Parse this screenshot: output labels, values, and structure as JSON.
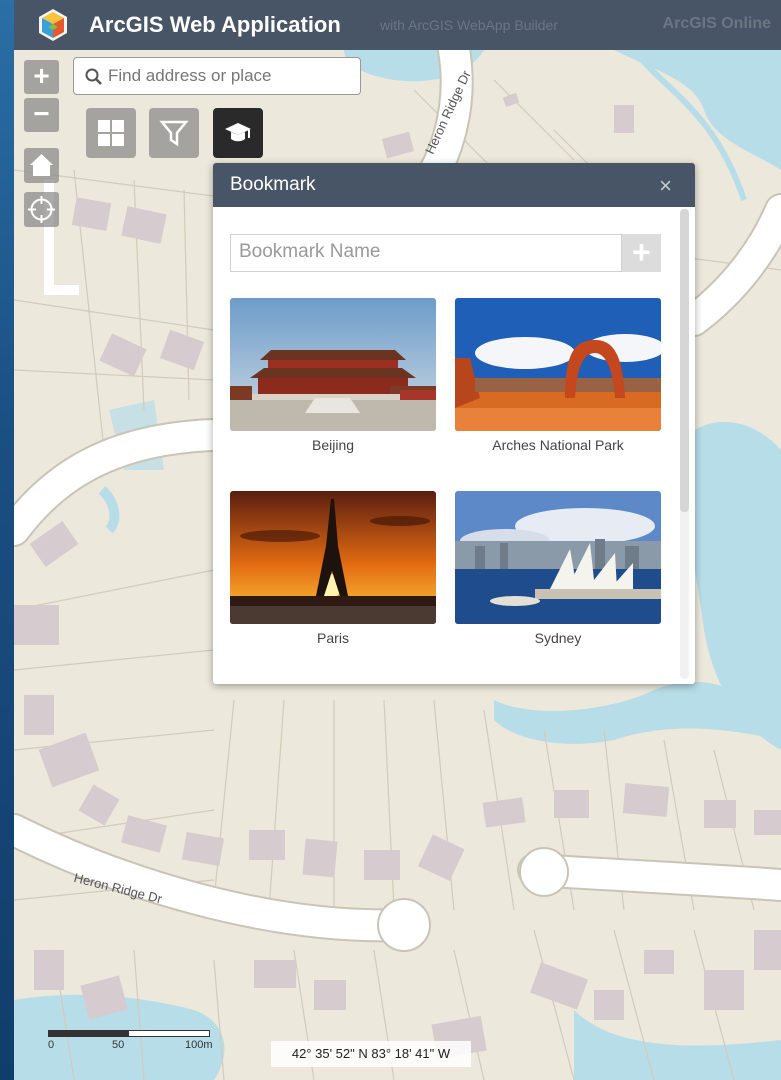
{
  "header": {
    "title": "ArcGIS Web Application",
    "subtitle": "with ArcGIS WebApp Builder",
    "right_link": "ArcGIS Online"
  },
  "search": {
    "placeholder": "Find address or place"
  },
  "zoom": {
    "in_label": "+",
    "out_label": "−"
  },
  "toolbar": {
    "buttons": [
      {
        "icon": "grid-icon",
        "active": false
      },
      {
        "icon": "filter-icon",
        "active": false
      },
      {
        "icon": "bookmark-graduation-cap-icon",
        "active": true
      }
    ]
  },
  "bookmark_panel": {
    "title": "Bookmark",
    "close_glyph": "×",
    "name_placeholder": "Bookmark Name",
    "add_label": "+",
    "bookmarks": [
      {
        "label": "Beijing"
      },
      {
        "label": "Arches National Park"
      },
      {
        "label": "Paris"
      },
      {
        "label": "Sydney"
      }
    ]
  },
  "map": {
    "streets": [
      "Heron Ridge Dr",
      "Heron Ridge Dr"
    ],
    "scalebar": {
      "ticks": [
        "0",
        "50",
        "100m"
      ]
    },
    "coordinates": "42° 35' 52\" N 83° 18' 41\" W"
  },
  "colors": {
    "header_bg": "#485566",
    "map_bg": "#ece8dc",
    "water": "#b7dde8",
    "building": "#d8cdd0",
    "road": "#ffffff"
  }
}
